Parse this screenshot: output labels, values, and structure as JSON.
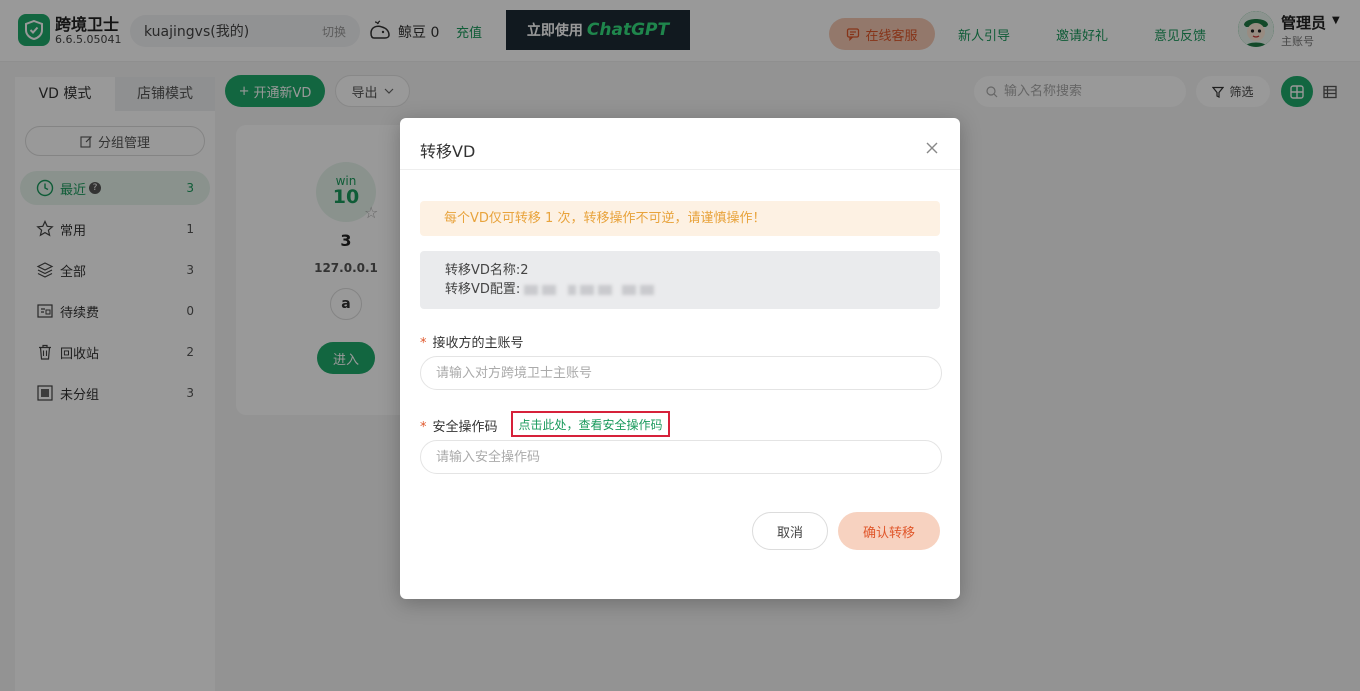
{
  "colors": {
    "brand": "#1faa6c",
    "accent_orange": "#e0572b",
    "warning_text": "#e8a33c",
    "highlight_border": "#d6213a"
  },
  "app": {
    "name": "跨境卫士",
    "version": "6.6.5.05041",
    "logo_icon": "shield-icon"
  },
  "header": {
    "account_name": "kuajingvs(我的)",
    "switch_label": "切换",
    "beans_label": "鲸豆 0",
    "recharge_label": "充值",
    "banner": {
      "text1": "立即使用",
      "text2": "ChatGPT"
    },
    "service_label": "在线客服",
    "links": [
      "新人引导",
      "邀请好礼",
      "意见反馈"
    ],
    "user_name": "管理员",
    "user_role": "主账号"
  },
  "sidebar": {
    "tabs": [
      "VD 模式",
      "店铺模式"
    ],
    "group_manage_label": "分组管理",
    "items": [
      {
        "label": "最近",
        "count": "3",
        "icon": "clock-icon"
      },
      {
        "label": "常用",
        "count": "1",
        "icon": "star-icon"
      },
      {
        "label": "全部",
        "count": "3",
        "icon": "layers-icon"
      },
      {
        "label": "待续费",
        "count": "0",
        "icon": "renew-icon"
      },
      {
        "label": "回收站",
        "count": "2",
        "icon": "trash-icon"
      },
      {
        "label": "未分组",
        "count": "3",
        "icon": "ungrouped-icon"
      }
    ]
  },
  "toolbar": {
    "new_vd_label": "开通新VD",
    "export_label": "导出",
    "search_placeholder": "输入名称搜索",
    "filter_label": "筛选"
  },
  "card": {
    "os_name": "win",
    "os_version": "10",
    "vd_name": "3",
    "ip": "127.0.0.1",
    "platform_initial": "a",
    "enter_label": "进入"
  },
  "modal": {
    "title": "转移VD",
    "warning": "每个VD仅可转移 1 次，转移操作不可逆，请谨慎操作！",
    "vd_name_line": "转移VD名称:2",
    "vd_config_label": "转移VD配置:",
    "receiver_label": "接收方的主账号",
    "receiver_placeholder": "请输入对方跨境卫士主账号",
    "code_label": "安全操作码",
    "code_link": "点击此处，查看安全操作码",
    "code_placeholder": "请输入安全操作码",
    "cancel_label": "取消",
    "confirm_label": "确认转移"
  }
}
